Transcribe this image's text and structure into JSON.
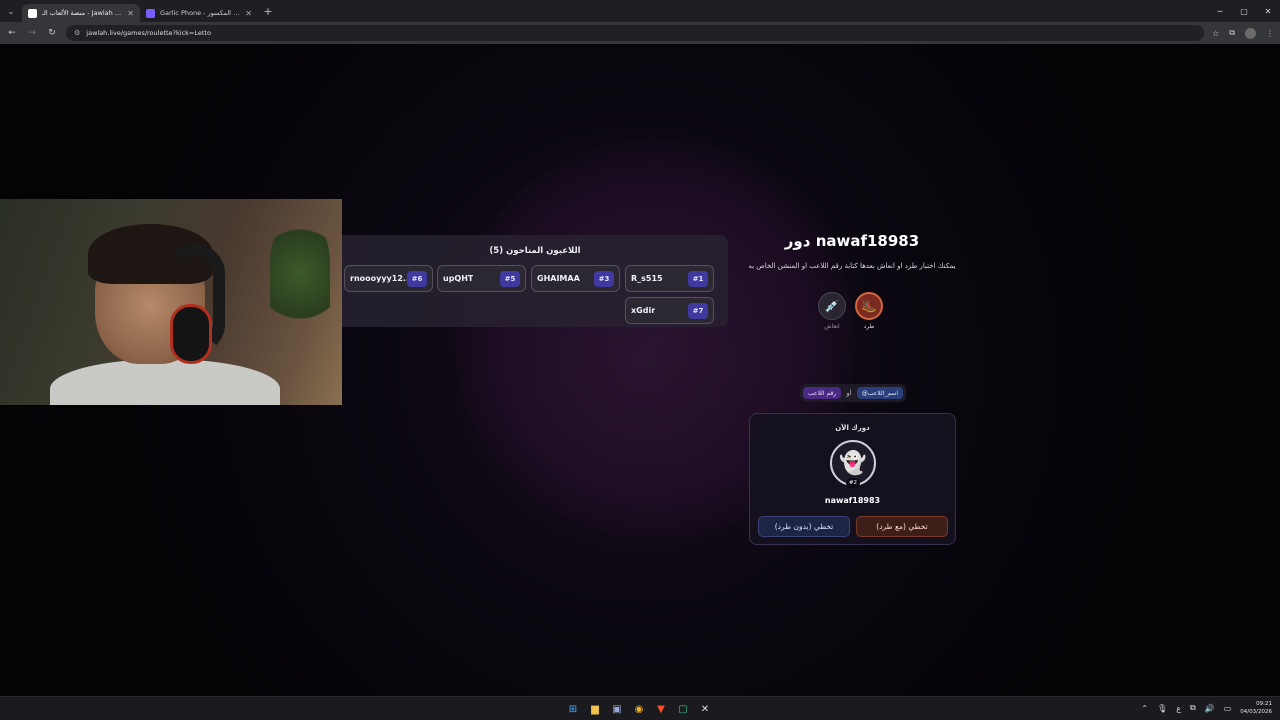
{
  "browser": {
    "tabs": [
      {
        "title": "منصة الألعاب الـ - Jawlah | جولة",
        "active": true
      },
      {
        "title": "Garlic Phone - الهاتف المكسور",
        "active": false
      }
    ],
    "url": "jawlah.live/games/roulette?kick=Letto"
  },
  "players": {
    "title": "اللاعبون المتاحون (5)",
    "list": [
      {
        "name": "R_s515",
        "num": "#1"
      },
      {
        "name": "GHAIMAA",
        "num": "#3"
      },
      {
        "name": "upQHT",
        "num": "#5"
      },
      {
        "name": "rnoooyyy12...",
        "num": "#6"
      },
      {
        "name": "xGdir",
        "num": "#7"
      }
    ]
  },
  "turn": {
    "title": "دور nawaf18983",
    "description": "يمكنك اختيار طرد او انعاش بعدها كتابة رقم اللاعب او المنشن الخاص به",
    "kick_label": "طرد",
    "revive_label": "انعاش",
    "mention_name": "@اسم_اللاعب",
    "or_label": "او",
    "mention_number": "رقم اللاعب"
  },
  "current": {
    "label": "دورك الآن",
    "badge": "#2",
    "name": "nawaf18983",
    "skip_with_kick": "تخطي (مع طرد)",
    "skip_without_kick": "تخطي (بدون طرد)"
  },
  "taskbar": {
    "time": "09:21",
    "date": "04/03/2026",
    "lang": "ع"
  },
  "icons": [
    "tab-menu-icon",
    "close-icon",
    "back-icon",
    "forward-icon",
    "reload-icon",
    "site-info-icon",
    "star-icon",
    "extensions-icon",
    "profile-icon",
    "kick-icon",
    "revive-icon",
    "ghost-avatar-icon"
  ],
  "colors": {
    "accent_purple": "#3f3aa0",
    "kick_orange": "#d0653e",
    "background": "#050308"
  }
}
